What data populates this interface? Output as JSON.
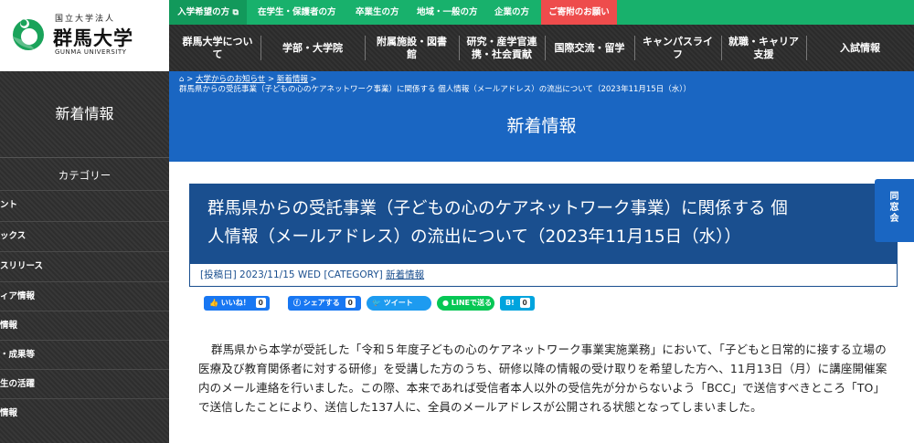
{
  "logo": {
    "sub": "国立大学法人",
    "main": "群馬大学",
    "english": "GUNMA UNIVERSITY",
    "icon": "gunma-university-logo"
  },
  "topbar": {
    "items": [
      {
        "label": "入学希望の方",
        "icon": "external-link-icon"
      },
      {
        "label": "在学生・保護者の方"
      },
      {
        "label": "卒業生の方"
      },
      {
        "label": "地域・一般の方"
      },
      {
        "label": "企業の方"
      },
      {
        "label": "ご寄附のお願い"
      }
    ],
    "colors": {
      "bar": "#18b16c",
      "first": "#12995b",
      "donate": "#ee4c4c"
    }
  },
  "mainnav": {
    "items": [
      {
        "line1": "群馬大学につい",
        "line2": "て"
      },
      {
        "line1": "学部・大学院",
        "line2": ""
      },
      {
        "line1": "附属施設・図書",
        "line2": "館"
      },
      {
        "line1": "研究・産学官連",
        "line2": "携・社会貢献"
      },
      {
        "line1": "国際交流・留学",
        "line2": ""
      },
      {
        "line1": "キャンパスライ",
        "line2": "フ"
      },
      {
        "line1": "就職・キャリア",
        "line2": "支援"
      },
      {
        "line1": "入試情報",
        "line2": ""
      }
    ]
  },
  "sidebar": {
    "title": "新着情報",
    "category_title": "カテゴリー",
    "categories": [
      "ント",
      "ックス",
      "スリリース",
      "ィア情報",
      "情報",
      "・成果等",
      "生の活躍",
      "情報"
    ]
  },
  "breadcrumb": {
    "home_icon": "home-icon",
    "sep": ">",
    "links": [
      "大学からのお知らせ",
      "新着情報"
    ],
    "current": "群馬県からの受託事業（子どもの心のケアネットワーク事業）に関係する 個人情報（メールアドレス）の流出について（2023年11月15日（水））"
  },
  "page_title": "新着情報",
  "article": {
    "title_line1": "群馬県からの受託事業（子どもの心のケアネットワーク事業）に関係する 個",
    "title_line2": "人情報（メールアドレス）の流出について（2023年11月15日（水））",
    "posted_label": "[投稿日]",
    "posted_date": "2023/11/15 WED",
    "category_label": "[CATEGORY]",
    "category": "新着情報",
    "body": "群馬県から本学が受託した「令和５年度子どもの心のケアネットワーク事業実施業務」において、「子どもと日常的に接する立場の医療及び教育関係者に対する研修」を受講した方のうち、研修以降の情報の受け取りを希望した方へ、11月13日（月）に講座開催案内のメール連絡を行いました。この際、本来であれば受信者本人以外の受信先が分からないよう「BCC」で送信すべきところ「TO」で送信したことにより、送信した137人に、全員のメールアドレスが公開される状態となってしまいました。"
  },
  "share": {
    "like": {
      "label": "いいね！",
      "count": "0",
      "icon": "thumbs-up-icon"
    },
    "facebook": {
      "label": "シェアする",
      "count": "0",
      "icon": "facebook-icon"
    },
    "twitter": {
      "label": "ツイート",
      "icon": "twitter-bird-icon"
    },
    "line": {
      "label": "LINEで送る",
      "icon": "line-icon"
    },
    "hatena": {
      "label": "B!",
      "count": "0",
      "icon": "hatena-bookmark-icon"
    }
  },
  "contact_tab": {
    "line1": "同",
    "line2": "窓",
    "line3": "会"
  }
}
